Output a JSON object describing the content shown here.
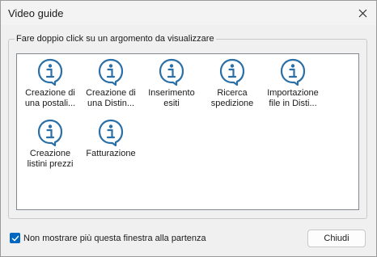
{
  "window": {
    "title": "Video guide"
  },
  "group": {
    "label": "Fare doppio click su un argomento da visualizzare"
  },
  "items": [
    {
      "line1": "Creazione di",
      "line2": "una postali...",
      "icon": "info-bubble-icon"
    },
    {
      "line1": "Creazione di",
      "line2": "una Distin...",
      "icon": "info-bubble-icon"
    },
    {
      "line1": "Inserimento",
      "line2": "esiti",
      "icon": "info-bubble-icon"
    },
    {
      "line1": "Ricerca",
      "line2": "spedizione",
      "icon": "info-bubble-icon"
    },
    {
      "line1": "Importazione",
      "line2": "file in Disti...",
      "icon": "info-bubble-icon"
    },
    {
      "line1": "Creazione",
      "line2": "listini prezzi",
      "icon": "info-bubble-icon"
    },
    {
      "line1": "Fatturazione",
      "line2": "",
      "icon": "info-bubble-icon"
    }
  ],
  "footer": {
    "checkbox_label": "Non mostrare più questa finestra alla partenza",
    "checkbox_checked": true,
    "close_label": "Chiudi"
  },
  "colors": {
    "icon": "#2a6fa6",
    "accent": "#0067c0"
  }
}
